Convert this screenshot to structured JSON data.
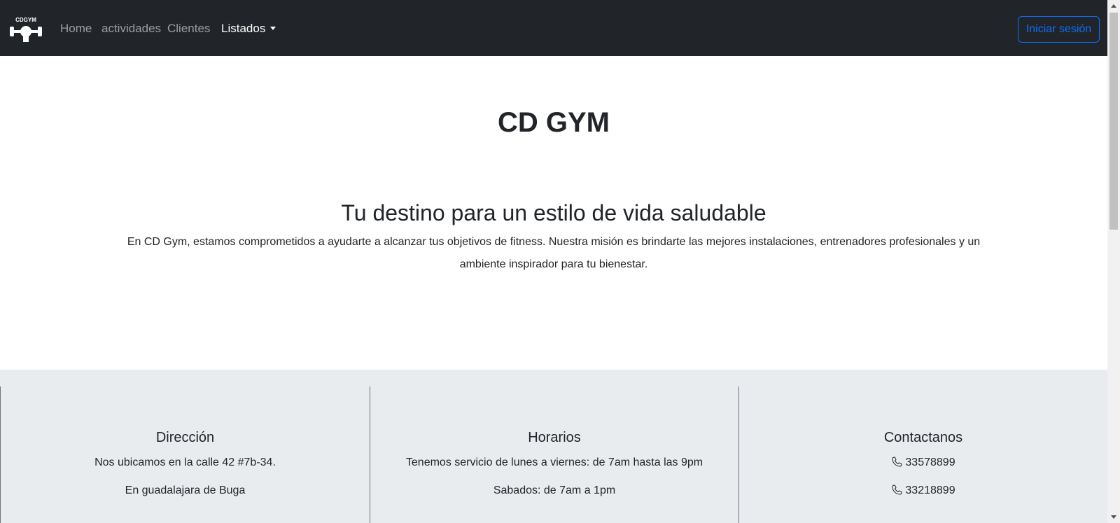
{
  "navbar": {
    "logo_text": "CDGYM",
    "links": [
      {
        "label": "Home"
      },
      {
        "label": "actividades"
      },
      {
        "label": "Clientes"
      }
    ],
    "dropdown_label": "Listados",
    "login_label": "Iniciar sesión"
  },
  "hero": {
    "title": "CD GYM",
    "subtitle": "Tu destino para un estilo de vida saludable",
    "text": "En CD Gym, estamos comprometidos a ayudarte a alcanzar tus objetivos de fitness. Nuestra misión es brindarte las mejores instalaciones, entrenadores profesionales y un ambiente inspirador para tu bienestar."
  },
  "footer": {
    "address": {
      "title": "Dirección",
      "line1": "Nos ubicamos en la calle 42 #7b-34.",
      "line2": "En guadalajara de Buga"
    },
    "hours": {
      "title": "Horarios",
      "line1": "Tenemos servicio de lunes a viernes: de 7am hasta las 9pm",
      "line2": "Sabados: de 7am a 1pm"
    },
    "contact": {
      "title": "Contactanos",
      "phone1": "33578899",
      "phone2": "33218899"
    }
  },
  "colors": {
    "navbar_bg": "#212529",
    "accent": "#0d6efd",
    "footer_bg": "#e9ecef"
  },
  "icons": [
    "logo-icon",
    "caret-down-icon",
    "phone-icon"
  ]
}
